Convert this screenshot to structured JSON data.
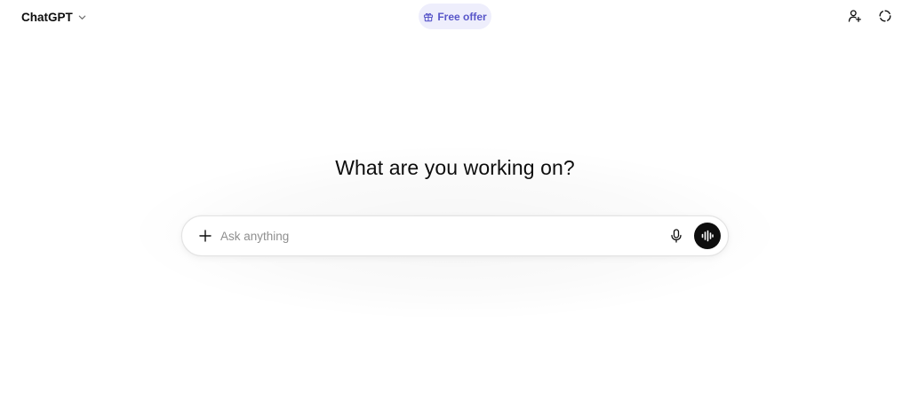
{
  "header": {
    "model_name": "ChatGPT",
    "model_icon": "chevron-down-icon",
    "offer_label": "Free offer",
    "offer_icon": "gift-icon",
    "offer_color": "#5856c9",
    "right_icons": [
      "add-person-icon",
      "temporary-chat-icon"
    ]
  },
  "main": {
    "headline": "What are you working on?",
    "composer": {
      "placeholder": "Ask anything",
      "value": "",
      "left_icon": "plus-icon",
      "right_icons": [
        "microphone-icon",
        "voice-mode-icon"
      ]
    }
  }
}
